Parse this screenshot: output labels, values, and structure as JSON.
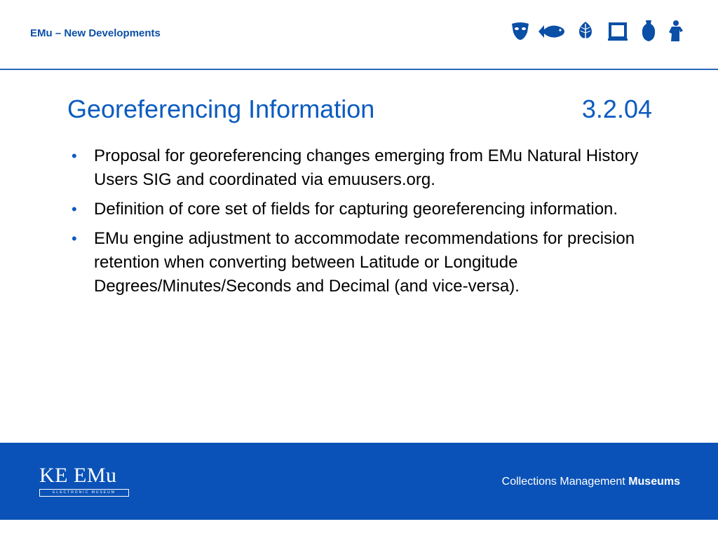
{
  "header": {
    "title": "EMu – New Developments",
    "icons": [
      "mask-icon",
      "fish-icon",
      "leaf-icon",
      "frame-icon",
      "vase-icon",
      "figure-icon"
    ]
  },
  "slide": {
    "title": "Georeferencing Information",
    "version": "3.2.04",
    "bullets": [
      "Proposal for georeferencing changes emerging from EMu Natural History Users SIG and coordinated via emuusers.org.",
      "Definition of core set of fields for capturing georeferencing information.",
      "EMu engine adjustment to accommodate recommendations for precision retention when converting between Latitude or Longitude Degrees/Minutes/Seconds and Decimal (and vice-versa)."
    ],
    "bullet_glyph": "•"
  },
  "footer": {
    "logo": "KE EMu",
    "logo_sub": "ELECTRONIC MUSEUM",
    "tagline_prefix": "Collections Management",
    "tagline_bold": "Museums"
  },
  "colors": {
    "accent": "#0b5bbf",
    "footer": "#0a52b7",
    "header_text": "#0b4fa6"
  }
}
